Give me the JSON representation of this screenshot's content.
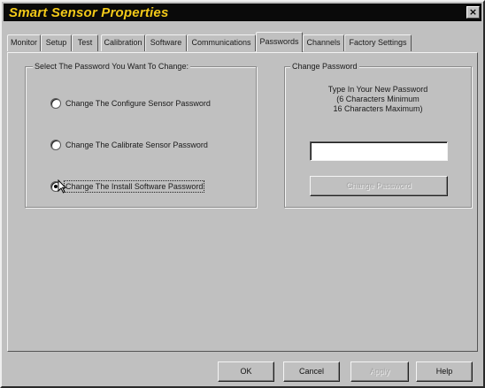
{
  "window": {
    "title": "Smart Sensor Properties",
    "close_glyph": "×"
  },
  "tabs": [
    {
      "label": "Monitor",
      "active": false
    },
    {
      "label": "Setup",
      "active": false
    },
    {
      "label": "Test",
      "active": false
    },
    {
      "label": "Calibration",
      "active": false
    },
    {
      "label": "Software",
      "active": false
    },
    {
      "label": "Communications",
      "active": false
    },
    {
      "label": "Passwords",
      "active": true
    },
    {
      "label": "Channels",
      "active": false
    },
    {
      "label": "Factory Settings",
      "active": false
    }
  ],
  "select_group": {
    "legend": "Select The Password You Want To Change:",
    "options": [
      {
        "label": "Change The Configure Sensor Password",
        "selected": false
      },
      {
        "label": "Change The Calibrate Sensor Password",
        "selected": false
      },
      {
        "label": "Change The Install Software Password",
        "selected": true
      }
    ]
  },
  "change_group": {
    "legend": "Change Password",
    "instructions": [
      "Type In Your New Password",
      "(6 Characters Minimum",
      "16 Characters Maximum)"
    ],
    "new_password_value": "",
    "change_button_label": "Change Password"
  },
  "footer": {
    "ok_label": "OK",
    "cancel_label": "Cancel",
    "apply_label": "Apply",
    "help_label": "Help"
  },
  "colors": {
    "title_text": "#f2c919",
    "title_bar": "#0a0a0a",
    "face": "#c0c0c0"
  },
  "icons": {
    "close": "close-icon",
    "cursor": "mouse-pointer-icon"
  }
}
